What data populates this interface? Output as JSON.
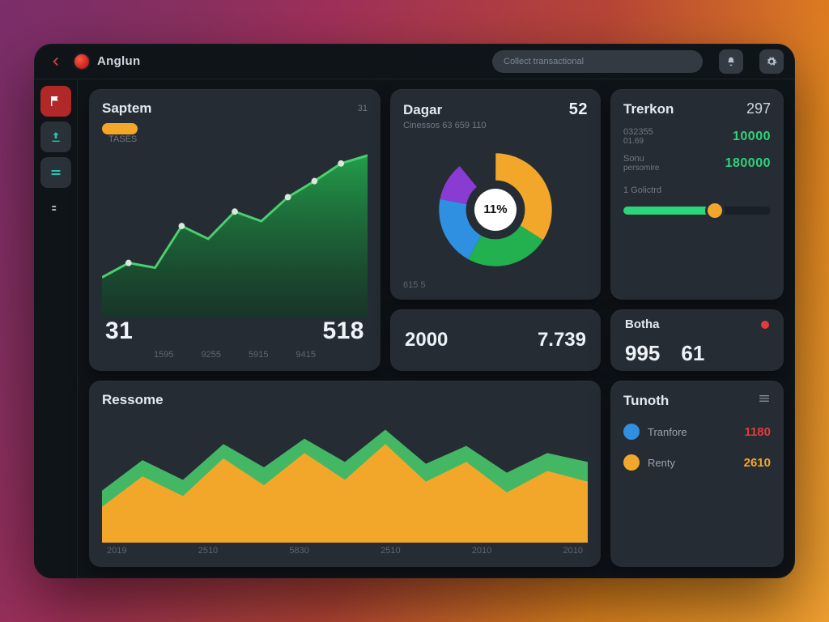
{
  "header": {
    "app_title": "Anglun",
    "search_placeholder": "Collect transactional"
  },
  "sidebar": {
    "items": [
      {
        "name": "home",
        "icon": "flag"
      },
      {
        "name": "signal",
        "icon": "signal"
      },
      {
        "name": "list",
        "icon": "lines"
      },
      {
        "name": "more",
        "icon": "dashes"
      }
    ]
  },
  "cards": {
    "saptem": {
      "title": "Saptem",
      "pill_label": "TASES",
      "hdr_meta": "31",
      "left_value": "31",
      "right_value": "518",
      "axis": [
        "1595",
        "9255",
        "5915",
        "9415"
      ]
    },
    "dagar": {
      "title": "Dagar",
      "hdr_value": "52",
      "subtitle": "Cinessos 63 659 110",
      "center": "11%",
      "footer": "615 5"
    },
    "trerkon": {
      "title": "Trerkon",
      "hdr_value": "297",
      "rows": [
        {
          "label": "032355",
          "sub": "01.69",
          "value": "10000"
        },
        {
          "label": "Sonu",
          "sub": "persomire",
          "value": "180000"
        }
      ],
      "progress_label": "1 Golictrd"
    },
    "mid": {
      "left": "2000",
      "right": "7.739"
    },
    "botha": {
      "title": "Botha",
      "left": "995",
      "right": "61"
    },
    "ressome": {
      "title": "Ressome",
      "axis": [
        "2019",
        "2510",
        "5830",
        "2510",
        "2010",
        "2010"
      ]
    },
    "tunoth": {
      "title": "Tunoth",
      "items": [
        {
          "color": "#2f8fe0",
          "label": "Tranfore",
          "value": "1180",
          "tone": "red"
        },
        {
          "color": "#f2a72b",
          "label": "Renty",
          "value": "2610",
          "tone": "amber"
        }
      ]
    }
  },
  "colors": {
    "green": "#23b04e",
    "green_light": "#4ad06e",
    "orange": "#f2a72b",
    "blue": "#2f8fe0",
    "purple": "#8a3bd1",
    "red": "#e23b3b",
    "teal": "#1fc7b0"
  },
  "chart_data": [
    {
      "id": "saptem",
      "type": "area",
      "x": [
        0,
        1,
        2,
        3,
        4,
        5,
        6,
        7,
        8,
        9
      ],
      "values": [
        28,
        36,
        34,
        58,
        50,
        66,
        60,
        74,
        84,
        96
      ],
      "ylim": [
        0,
        100
      ],
      "title": "Saptem",
      "color": "#23b04e"
    },
    {
      "id": "dagar",
      "type": "pie",
      "title": "Dagar",
      "slices": [
        {
          "label": "orange",
          "value": 34,
          "color": "#f2a72b"
        },
        {
          "label": "green",
          "value": 24,
          "color": "#23b04e"
        },
        {
          "label": "blue",
          "value": 20,
          "color": "#2f8fe0"
        },
        {
          "label": "purple",
          "value": 11,
          "color": "#8a3bd1"
        },
        {
          "label": "gap",
          "value": 11,
          "color": "#ffffff"
        }
      ],
      "center_label": "11%"
    },
    {
      "id": "trerkon_progress",
      "type": "bar",
      "categories": [
        "progress"
      ],
      "values": [
        62
      ],
      "ylim": [
        0,
        100
      ]
    },
    {
      "id": "ressome",
      "type": "area",
      "categories": [
        "2019",
        "2510",
        "5830",
        "2510",
        "2010",
        "2010"
      ],
      "series": [
        {
          "name": "orange",
          "color": "#f2a72b",
          "values": [
            40,
            62,
            48,
            70,
            56,
            74,
            60,
            80,
            58,
            72,
            52,
            66
          ]
        },
        {
          "name": "green",
          "color": "#4ad06e",
          "values": [
            52,
            74,
            60,
            84,
            68,
            88,
            72,
            94,
            70,
            84,
            64,
            78
          ]
        }
      ],
      "ylim": [
        0,
        100
      ]
    }
  ]
}
